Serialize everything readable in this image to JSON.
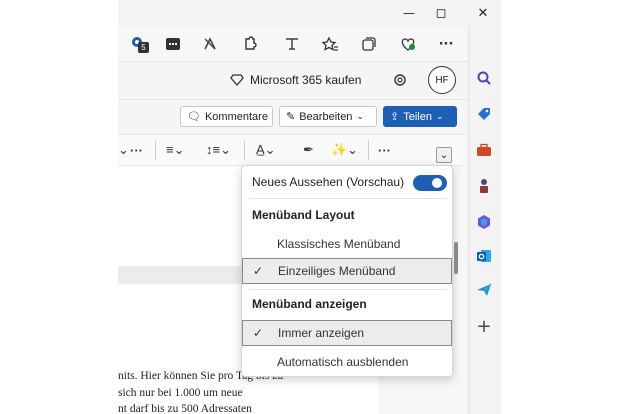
{
  "window": {
    "minimize": "—",
    "restore": "◻",
    "close": "✕"
  },
  "toolbar": {
    "badge": "5",
    "more": "···"
  },
  "header": {
    "buy_label": "Microsoft 365 kaufen",
    "avatar_initials": "HF"
  },
  "commands": {
    "comments": "Kommentare",
    "edit": "Bearbeiten",
    "share": "Teilen"
  },
  "ribbon": {
    "more1": "···",
    "more2": "···"
  },
  "panel": {
    "new_look_label": "Neues Aussehen (Vorschau)",
    "new_look_on": true,
    "layout_header": "Menüband Layout",
    "layout_options": [
      {
        "label": "Klassisches Menüband",
        "selected": false
      },
      {
        "label": "Einzeiliges Menüband",
        "selected": true
      }
    ],
    "show_header": "Menüband anzeigen",
    "show_options": [
      {
        "label": "Immer anzeigen",
        "selected": true
      },
      {
        "label": "Automatisch ausblenden",
        "selected": false
      }
    ]
  },
  "document": {
    "lines": [
      "nits. Hier können Sie pro Tag bis zu",
      "sich nur bei 1.000 um neue",
      "nt darf bis zu 500 Adressaten"
    ]
  },
  "colors": {
    "accent": "#1e5fb4",
    "panel_selected_bg": "#ececec"
  }
}
